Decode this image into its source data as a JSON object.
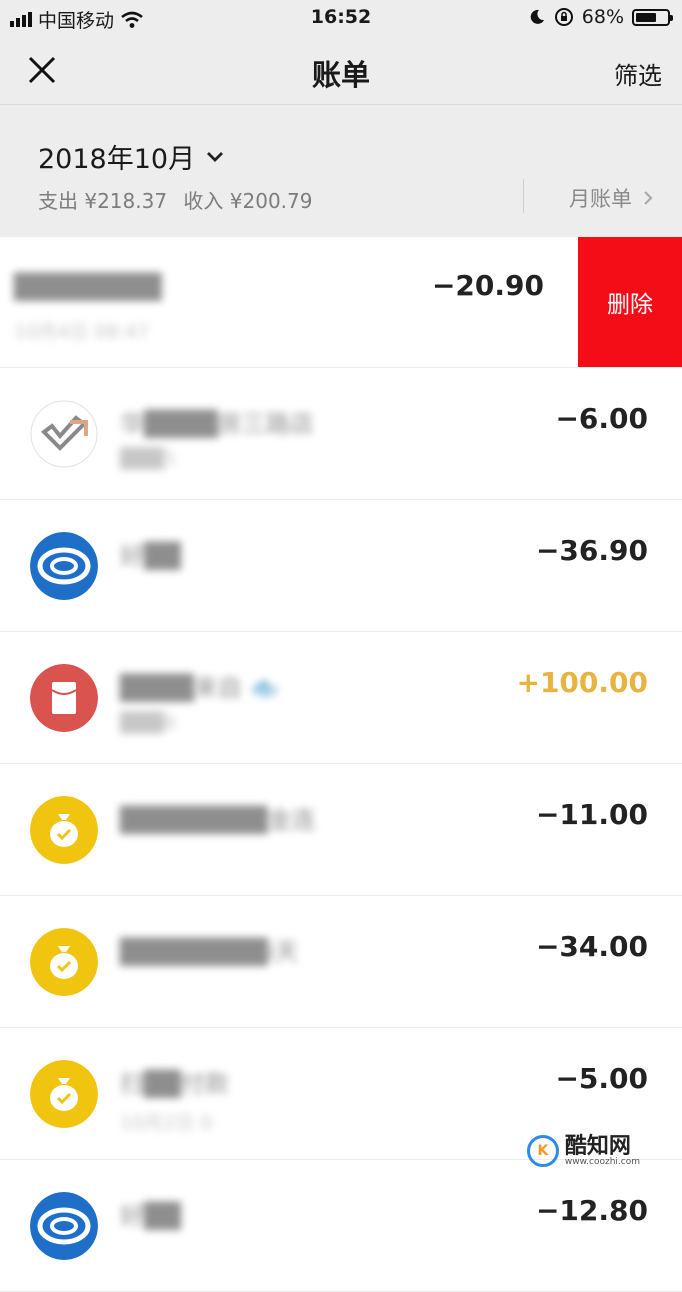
{
  "status_bar": {
    "carrier": "中国移动",
    "time": "16:52",
    "battery": "68%",
    "battery_level": 0.68
  },
  "navbar": {
    "title": "账单",
    "filter_label": "筛选"
  },
  "summary": {
    "month": "2018年10月",
    "expense": "支出 ¥218.37",
    "income": "收入 ¥200.79",
    "monthly_bill": "月账单"
  },
  "transactions": [
    {
      "title": "████████",
      "date": "10月4日 08:47",
      "amount": "−20.90",
      "type": "expense",
      "icon": "blurred",
      "delete_label": "删除"
    },
    {
      "title": "华████房三路店",
      "date": "███5",
      "amount": "−6.00",
      "type": "expense",
      "icon": "store-logo-icon"
    },
    {
      "title": "好██",
      "date": "",
      "amount": "−36.90",
      "type": "expense",
      "icon": "swirl-logo-icon"
    },
    {
      "title": "████来自 🐟",
      "date": "███8",
      "amount": "+100.00",
      "type": "income",
      "icon": "red-packet-icon"
    },
    {
      "title": "████████金连",
      "date": "",
      "amount": "−11.00",
      "type": "expense",
      "icon": "money-bag-icon"
    },
    {
      "title": "████████i天",
      "date": "",
      "amount": "−34.00",
      "type": "expense",
      "icon": "money-bag-icon"
    },
    {
      "title": "扫██付款",
      "date": "10月2日 0",
      "amount": "−5.00",
      "type": "expense",
      "icon": "money-bag-icon"
    },
    {
      "title": "好██",
      "date": "",
      "amount": "−12.80",
      "type": "expense",
      "icon": "swirl-logo-icon"
    }
  ],
  "watermark": {
    "text": "酷知网",
    "url": "www.coozhi.com"
  },
  "colors": {
    "delete": "#f40c17",
    "income": "#e8b33e",
    "money_bag": "#f1c40f",
    "red_packet": "#d9534f",
    "swirl_logo": "#1f6fc8"
  }
}
